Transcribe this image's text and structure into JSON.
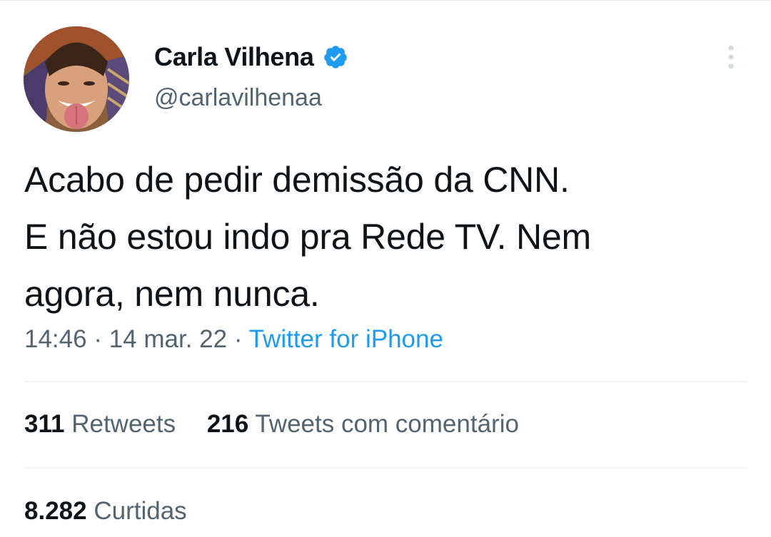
{
  "tweet": {
    "author": {
      "display_name": "Carla Vilhena",
      "handle": "@carlavilhenaa",
      "verified": true,
      "avatar_icon": "profile-photo"
    },
    "text_lines": [
      "Acabo de pedir demissão da CNN.",
      "E não estou indo pra Rede TV. Nem",
      "agora, nem nunca."
    ],
    "time": "14:46",
    "separator": "·",
    "date": "14 mar. 22",
    "source": "Twitter for iPhone",
    "stats": {
      "retweets_count": "311",
      "retweets_label": "Retweets",
      "quotes_count": "216",
      "quotes_label": "Tweets com comentário",
      "likes_count": "8.282",
      "likes_label": "Curtidas"
    }
  },
  "colors": {
    "text_primary": "#0f1419",
    "text_secondary": "#536471",
    "accent": "#1d9bf0",
    "divider": "#eff3f4"
  },
  "icons": {
    "verified": "verified-badge-icon",
    "more": "more-options-vertical-icon"
  }
}
